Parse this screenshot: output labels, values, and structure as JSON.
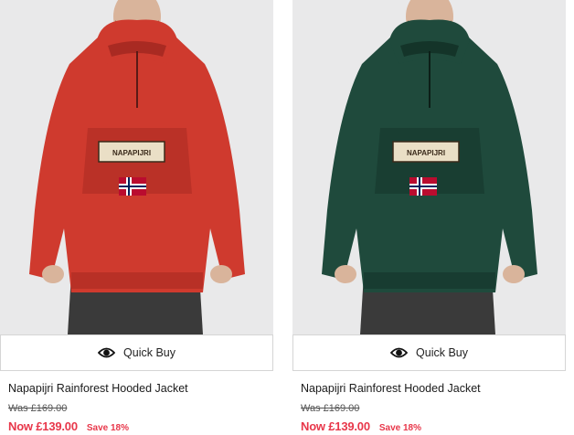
{
  "products": [
    {
      "image": "model-wearing-red-hooded-jacket",
      "jacket_color": "#cf3a2e",
      "jacket_shadow": "#a92a22",
      "quick_buy_label": "Quick Buy",
      "quick_buy_icon": "eye-icon",
      "title": "Napapijri Rainforest Hooded Jacket",
      "was_price": "Was £169.00",
      "now_price": "Now  £139.00",
      "save_text": "Save 18%",
      "badge_text": "NAPAPIJRI"
    },
    {
      "image": "model-wearing-green-hooded-jacket",
      "jacket_color": "#1f4a3c",
      "jacket_shadow": "#143429",
      "quick_buy_label": "Quick Buy",
      "quick_buy_icon": "eye-icon",
      "title": "Napapijri Rainforest Hooded Jacket",
      "was_price": "Was £169.00",
      "now_price": "Now  £139.00",
      "save_text": "Save 18%",
      "badge_text": "NAPAPIJRI"
    }
  ],
  "colors": {
    "sale_red": "#e8374a",
    "photo_bg": "#e9e9ea",
    "trousers": "#3a3a3a"
  }
}
